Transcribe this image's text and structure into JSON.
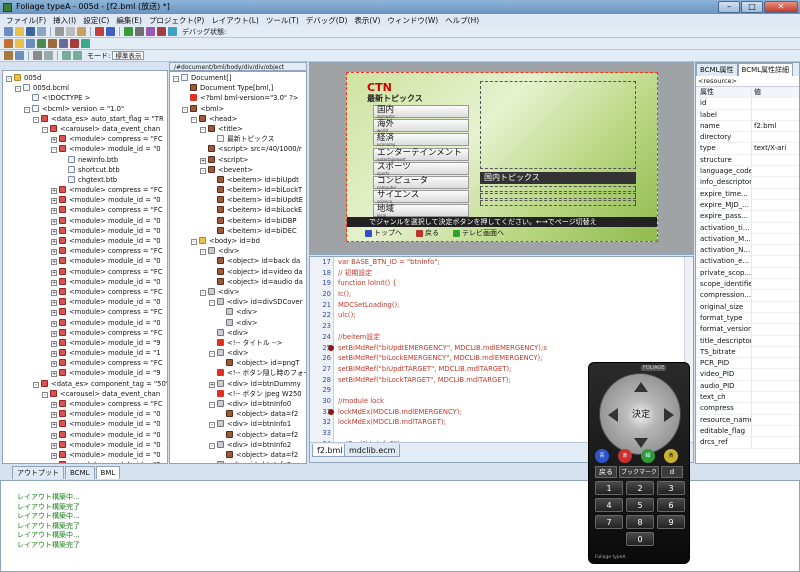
{
  "window": {
    "title": "Foliage typeA - 005d - [f2.bml (放送) *]"
  },
  "menu": [
    "ファイル(F)",
    "挿入(I)",
    "設定(C)",
    "編集(E)",
    "プロジェクト(P)",
    "レイアウト(L)",
    "ツール(T)",
    "デバッグ(D)",
    "表示(V)",
    "ウィンドウ(W)",
    "ヘルプ(H)"
  ],
  "toolbar": {
    "debug_label": "デバッグ状態:",
    "mode_label": "モード:",
    "mode_value": "標準表示"
  },
  "project_tree": [
    {
      "t": "005d",
      "ic": "folder",
      "d": 0,
      "e": "-"
    },
    {
      "t": "005d.bcml",
      "ic": "file",
      "d": 1,
      "e": "-"
    },
    {
      "t": "<!DOCTYPE >",
      "ic": "file",
      "d": 2,
      "e": ""
    },
    {
      "t": "<bcml> version = \"1.0\"",
      "ic": "file",
      "d": 2,
      "e": "-"
    },
    {
      "t": "<data_es> auto_start_flag = \"TR",
      "ic": "red",
      "d": 3,
      "e": "-"
    },
    {
      "t": "<carousel> data_event_chan",
      "ic": "red",
      "d": 4,
      "e": "-"
    },
    {
      "t": "<module> compress = \"FC",
      "ic": "red",
      "d": 5,
      "e": "+"
    },
    {
      "t": "<module> module_id = \"0",
      "ic": "red",
      "d": 5,
      "e": "-"
    },
    {
      "t": "newinfo.btb",
      "ic": "file",
      "d": 6,
      "e": ""
    },
    {
      "t": "shortcut.btb",
      "ic": "file",
      "d": 6,
      "e": ""
    },
    {
      "t": "chgtext.btb",
      "ic": "file",
      "d": 6,
      "e": ""
    },
    {
      "t": "<module> compress = \"FC",
      "ic": "red",
      "d": 5,
      "e": "+"
    },
    {
      "t": "<module> module_id = \"0",
      "ic": "red",
      "d": 5,
      "e": "+"
    },
    {
      "t": "<module> compress = \"FC",
      "ic": "red",
      "d": 5,
      "e": "+"
    },
    {
      "t": "<module> module_id = \"0",
      "ic": "red",
      "d": 5,
      "e": "+"
    },
    {
      "t": "<module> module_id = \"0",
      "ic": "red",
      "d": 5,
      "e": "+"
    },
    {
      "t": "<module> module_id = \"0",
      "ic": "red",
      "d": 5,
      "e": "+"
    },
    {
      "t": "<module> compress = \"FC",
      "ic": "red",
      "d": 5,
      "e": "+"
    },
    {
      "t": "<module> module_id = \"0",
      "ic": "red",
      "d": 5,
      "e": "+"
    },
    {
      "t": "<module> compress = \"FC",
      "ic": "red",
      "d": 5,
      "e": "+"
    },
    {
      "t": "<module> module_id = \"0",
      "ic": "red",
      "d": 5,
      "e": "+"
    },
    {
      "t": "<module> compress = \"FC",
      "ic": "red",
      "d": 5,
      "e": "+"
    },
    {
      "t": "<module> module_id = \"0",
      "ic": "red",
      "d": 5,
      "e": "+"
    },
    {
      "t": "<module> compress = \"FC",
      "ic": "red",
      "d": 5,
      "e": "+"
    },
    {
      "t": "<module> module_id = \"0",
      "ic": "red",
      "d": 5,
      "e": "+"
    },
    {
      "t": "<module> compress = \"FC",
      "ic": "red",
      "d": 5,
      "e": "+"
    },
    {
      "t": "<module> module_id = \"9",
      "ic": "red",
      "d": 5,
      "e": "+"
    },
    {
      "t": "<module> module_id = \"1",
      "ic": "red",
      "d": 5,
      "e": "+"
    },
    {
      "t": "<module> compress = \"FC",
      "ic": "red",
      "d": 5,
      "e": "+"
    },
    {
      "t": "<module> module_id = \"9",
      "ic": "red",
      "d": 5,
      "e": "+"
    },
    {
      "t": "<data_es> component_tag = \"50\"",
      "ic": "red",
      "d": 3,
      "e": "-"
    },
    {
      "t": "<carousel> data_event_chan",
      "ic": "red",
      "d": 4,
      "e": "-"
    },
    {
      "t": "<module> compress = \"FC",
      "ic": "red",
      "d": 5,
      "e": "+"
    },
    {
      "t": "<module> module_id = \"0",
      "ic": "red",
      "d": 5,
      "e": "+"
    },
    {
      "t": "<module> module_id = \"0",
      "ic": "red",
      "d": 5,
      "e": "+"
    },
    {
      "t": "<module> module_id = \"0",
      "ic": "red",
      "d": 5,
      "e": "+"
    },
    {
      "t": "<module> module_id = \"0",
      "ic": "red",
      "d": 5,
      "e": "+"
    },
    {
      "t": "<module> module_id = \"0",
      "ic": "red",
      "d": 5,
      "e": "+"
    },
    {
      "t": "<module> module_id = \"0",
      "ic": "red",
      "d": 5,
      "e": "+"
    },
    {
      "t": "<module> module_id = \"0",
      "ic": "red",
      "d": 5,
      "e": "+"
    },
    {
      "t": "<module> module_id = \"0",
      "ic": "red",
      "d": 5,
      "e": "+"
    },
    {
      "t": "<module> compress = \"FC",
      "ic": "red",
      "d": 5,
      "e": "+"
    },
    {
      "t": "<module> compress = \"FC",
      "ic": "red",
      "d": 5,
      "e": "+"
    }
  ],
  "dom_path": "/#document/bml/body/div/div/object",
  "dom_tree": [
    {
      "t": "Document[]",
      "ic": "file",
      "d": 0,
      "e": "-"
    },
    {
      "t": "Document Type[bml,]",
      "ic": "tag",
      "d": 1,
      "e": ""
    },
    {
      "t": "<?bml bml-version=\"3.0\" ?>",
      "ic": "excl",
      "d": 1,
      "e": ""
    },
    {
      "t": "<bml>",
      "ic": "tag",
      "d": 1,
      "e": "-"
    },
    {
      "t": "<head>",
      "ic": "tag",
      "d": 2,
      "e": "-"
    },
    {
      "t": "<title>",
      "ic": "tag",
      "d": 3,
      "e": "-"
    },
    {
      "t": "最新トピックス",
      "ic": "file",
      "d": 4,
      "e": ""
    },
    {
      "t": "<script> src=/40/1000/r",
      "ic": "tag",
      "d": 3,
      "e": ""
    },
    {
      "t": "<script>",
      "ic": "tag",
      "d": 3,
      "e": "+"
    },
    {
      "t": "<bevent>",
      "ic": "tag",
      "d": 3,
      "e": "-"
    },
    {
      "t": "<beitem> id=biUpdt",
      "ic": "tag",
      "d": 4,
      "e": ""
    },
    {
      "t": "<beitem> id=biLockT",
      "ic": "tag",
      "d": 4,
      "e": ""
    },
    {
      "t": "<beitem> id=biUpdtE",
      "ic": "tag",
      "d": 4,
      "e": ""
    },
    {
      "t": "<beitem> id=biLockE",
      "ic": "tag",
      "d": 4,
      "e": ""
    },
    {
      "t": "<beitem> id=biDBP",
      "ic": "tag",
      "d": 4,
      "e": ""
    },
    {
      "t": "<beitem> id=biDEC",
      "ic": "tag",
      "d": 4,
      "e": ""
    },
    {
      "t": "<body> id=bd",
      "ic": "folder",
      "d": 2,
      "e": "-"
    },
    {
      "t": "<div>",
      "ic": "grid",
      "d": 3,
      "e": "-"
    },
    {
      "t": "<object> id=back da",
      "ic": "tag",
      "d": 4,
      "e": ""
    },
    {
      "t": "<object> id=video da",
      "ic": "tag",
      "d": 4,
      "e": ""
    },
    {
      "t": "<object> id=audio da",
      "ic": "tag",
      "d": 4,
      "e": ""
    },
    {
      "t": "<div>",
      "ic": "grid",
      "d": 3,
      "e": "-"
    },
    {
      "t": "<div> id=divSDCover",
      "ic": "grid",
      "d": 4,
      "e": "-"
    },
    {
      "t": "<div>",
      "ic": "grid",
      "d": 5,
      "e": ""
    },
    {
      "t": "<div>",
      "ic": "grid",
      "d": 5,
      "e": ""
    },
    {
      "t": "<div>",
      "ic": "grid",
      "d": 4,
      "e": ""
    },
    {
      "t": "<!-- タイトル -->",
      "ic": "excl",
      "d": 4,
      "e": ""
    },
    {
      "t": "<div>",
      "ic": "grid",
      "d": 4,
      "e": "-"
    },
    {
      "t": "<object> id=pngT",
      "ic": "tag",
      "d": 5,
      "e": ""
    },
    {
      "t": "<!-- ボタン隠し時のフォー",
      "ic": "excl",
      "d": 4,
      "e": ""
    },
    {
      "t": "<div> id=btnDummy",
      "ic": "grid",
      "d": 4,
      "e": "+"
    },
    {
      "t": "<!-- ボタン jpeg W250",
      "ic": "excl",
      "d": 4,
      "e": ""
    },
    {
      "t": "<div> id=btnInfo0",
      "ic": "grid",
      "d": 4,
      "e": "-"
    },
    {
      "t": "<object> data=f2",
      "ic": "tag",
      "d": 5,
      "e": ""
    },
    {
      "t": "<div> id=btnInfo1",
      "ic": "grid",
      "d": 4,
      "e": "-"
    },
    {
      "t": "<object> data=f2",
      "ic": "tag",
      "d": 5,
      "e": ""
    },
    {
      "t": "<div> id=btnInfo2",
      "ic": "grid",
      "d": 4,
      "e": "-"
    },
    {
      "t": "<object> data=f2",
      "ic": "tag",
      "d": 5,
      "e": ""
    },
    {
      "t": "<div> id=btnInfo3",
      "ic": "grid",
      "d": 4,
      "e": "-"
    },
    {
      "t": "<object> data=f2",
      "ic": "tag",
      "d": 5,
      "e": ""
    },
    {
      "t": "<div> id=btnInfo4",
      "ic": "grid",
      "d": 4,
      "e": "-"
    },
    {
      "t": "<object> data=f2",
      "ic": "tag",
      "d": 5,
      "e": ""
    }
  ],
  "preview": {
    "logo": "CTN",
    "title": "最新トピックス",
    "categories": [
      {
        "label": "国内",
        "sub": "domestic"
      },
      {
        "label": "海外",
        "sub": "world"
      },
      {
        "label": "経済",
        "sub": "economy"
      },
      {
        "label": "エンターテインメント",
        "sub": "entertainment"
      },
      {
        "label": "スポーツ",
        "sub": "sports"
      },
      {
        "label": "コンピュータ",
        "sub": "computer"
      },
      {
        "label": "サイエンス",
        "sub": "science"
      },
      {
        "label": "地域",
        "sub": "local"
      }
    ],
    "topics_header": "国内トピックス",
    "help_text": "でジャンルを選択して決定ボタンを押してください。←→でページ切替え",
    "nav": [
      "トップへ",
      "戻る",
      "テレビ画面へ"
    ]
  },
  "editor": {
    "line_numbers": [
      "17",
      "18",
      "19",
      "20",
      "21",
      "22",
      "23",
      "24",
      "25",
      "26",
      "27",
      "28",
      "29",
      "30",
      "31",
      "32",
      "33",
      "34"
    ],
    "lines": [
      "var BASE_BTN_ID = \"btnInfo\";",
      "// 初期設定",
      "function loInit() {",
      "  Ic();",
      "  MDCSetLoading();",
      "  ulc();",
      "",
      "  //beitem設定",
      "  setBiMdRef(\"biUpdtEMERGENCY\", MDCLIB.mdlEMERGENCY);s",
      "  setBiMdRef(\"biLockEMERGENCY\", MDCLIB.mdlEMERGENCY);",
      "  setBiMdRef(\"biUpdtTARGET\", MDCLIB.mdlTARGET);",
      "  setBiMdRef(\"biLockTARGET\", MDCLIB.mdlTARGET);",
      "",
      "  //module lock",
      "  lockMdEx(MDCLIB.mdlEMERGENCY);",
      "  lockMdEx(MDCLIB.mdlTARGET);",
      "",
      "  setFcs(\"btnInfo0\");"
    ],
    "tabs": [
      "f2.bml",
      "mdclib.ecm"
    ]
  },
  "properties": {
    "tabs": [
      "BCML属性",
      "BCML属性詳細"
    ],
    "resource_label": "<resource>",
    "header": {
      "k": "属性",
      "v": "値"
    },
    "rows": [
      {
        "k": "id",
        "v": ""
      },
      {
        "k": "label",
        "v": ""
      },
      {
        "k": "name",
        "v": "f2.bml"
      },
      {
        "k": "directory",
        "v": ""
      },
      {
        "k": "type",
        "v": "text/X-ari"
      },
      {
        "k": "structure",
        "v": ""
      },
      {
        "k": "language_code",
        "v": ""
      },
      {
        "k": "info_descriptor",
        "v": ""
      },
      {
        "k": "expire_time...",
        "v": ""
      },
      {
        "k": "expire_MJD_...",
        "v": ""
      },
      {
        "k": "expire_pass...",
        "v": ""
      },
      {
        "k": "activation_ti...",
        "v": ""
      },
      {
        "k": "activation_M...",
        "v": ""
      },
      {
        "k": "activation_N...",
        "v": ""
      },
      {
        "k": "activation_e...",
        "v": ""
      },
      {
        "k": "private_scop...",
        "v": ""
      },
      {
        "k": "scope_identifier",
        "v": ""
      },
      {
        "k": "compression...",
        "v": ""
      },
      {
        "k": "original_size",
        "v": ""
      },
      {
        "k": "format_type",
        "v": ""
      },
      {
        "k": "format_version",
        "v": ""
      },
      {
        "k": "title_descriptor",
        "v": ""
      },
      {
        "k": "TS_bitrate",
        "v": ""
      },
      {
        "k": "PCR_PID",
        "v": ""
      },
      {
        "k": "video_PID",
        "v": ""
      },
      {
        "k": "audio_PID",
        "v": ""
      },
      {
        "k": "text_ch",
        "v": ""
      },
      {
        "k": "compress",
        "v": ""
      },
      {
        "k": "resource_name",
        "v": ""
      },
      {
        "k": "editable_flag",
        "v": ""
      },
      {
        "k": "drcs_ref",
        "v": ""
      }
    ]
  },
  "output": {
    "tabs": [
      "アウトプット",
      "BCML",
      "BML"
    ],
    "lines": [
      "レイアウト構築中...",
      "レイアウト構築完了",
      "レイアウト構築中...",
      "レイアウト構築完了",
      "レイアウト構築中...",
      "レイアウト構築完了"
    ]
  },
  "remote": {
    "brand": "FOLIAGE",
    "center": "決定",
    "color_keys": [
      "青",
      "赤",
      "緑",
      "黄"
    ],
    "func_keys": [
      "戻る",
      "ブックマーク",
      "d"
    ],
    "numbers": [
      "1",
      "2",
      "3",
      "4",
      "5",
      "6",
      "7",
      "8",
      "9",
      "0"
    ],
    "footer": "Foliage typeA"
  },
  "colors": {
    "accent": "#6a93bf",
    "code_text": "#c0392b",
    "output_text": "#1a7f1a"
  }
}
